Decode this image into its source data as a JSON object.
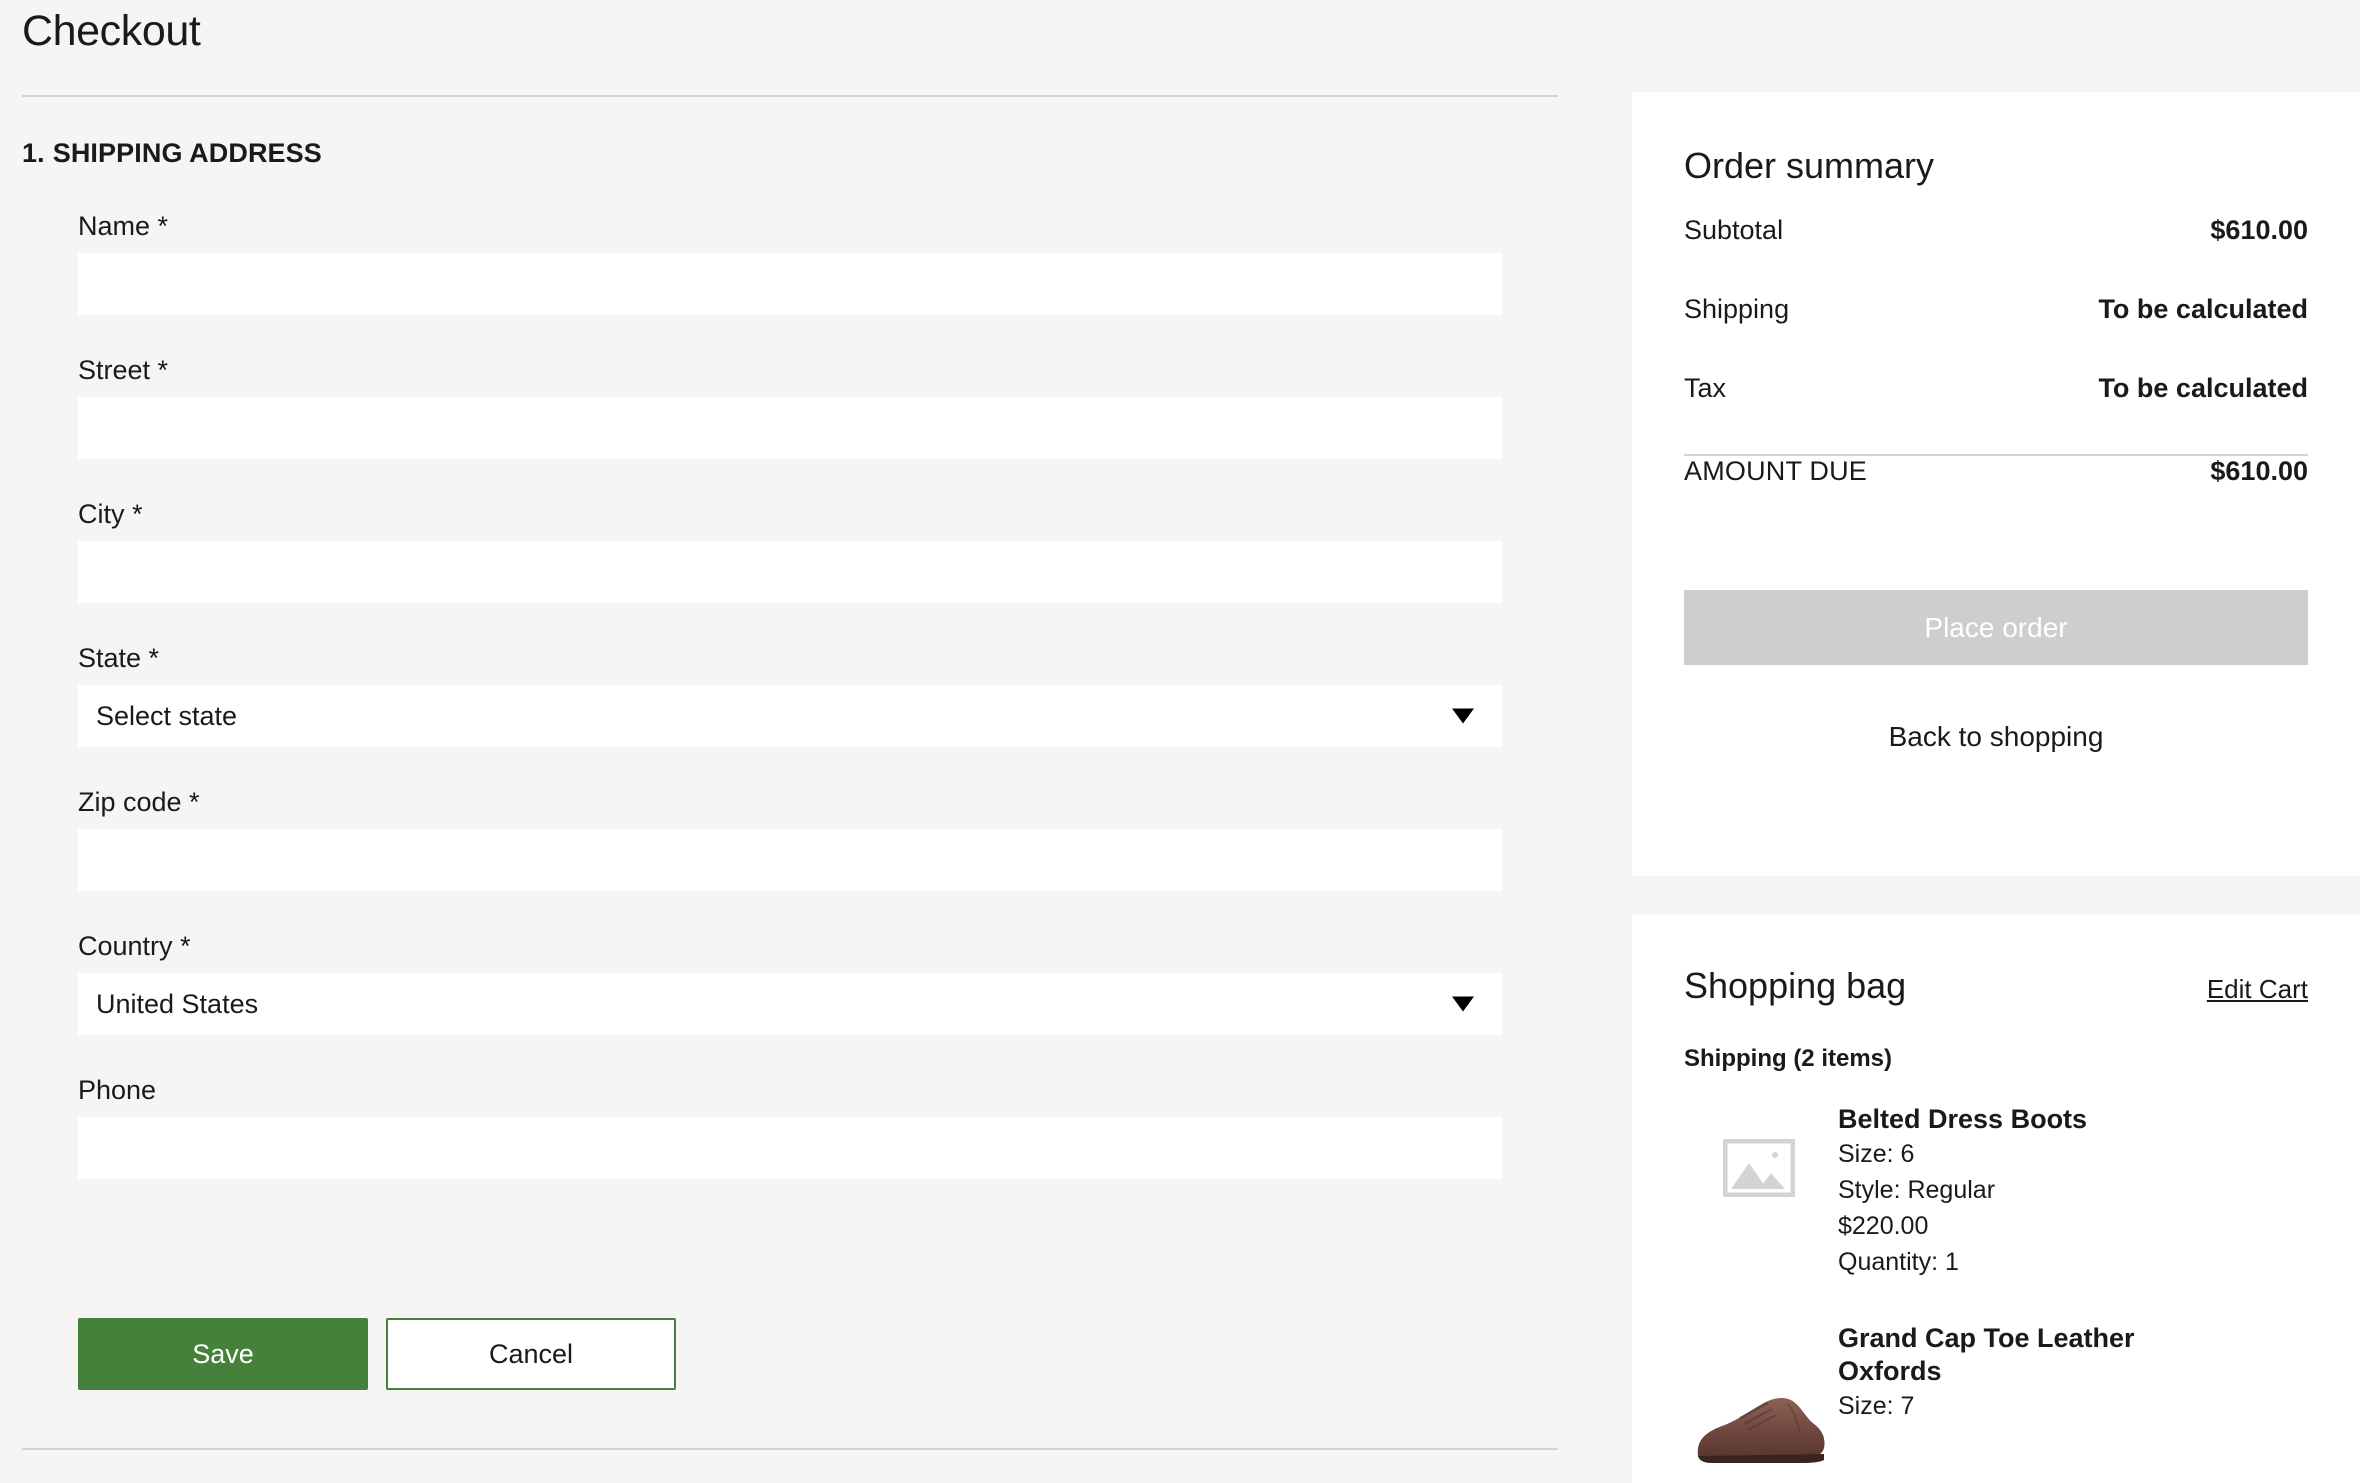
{
  "page": {
    "title": "Checkout"
  },
  "shipping_section": {
    "number": "1.",
    "heading": "SHIPPING ADDRESS",
    "fields": [
      {
        "label": "Name *",
        "value": "",
        "placeholder": "",
        "type": "text",
        "name": "name"
      },
      {
        "label": "Street *",
        "value": "",
        "placeholder": "",
        "type": "text",
        "name": "street"
      },
      {
        "label": "City *",
        "value": "",
        "placeholder": "",
        "type": "text",
        "name": "city"
      },
      {
        "label": "State *",
        "value": "Select state",
        "type": "select",
        "name": "state"
      },
      {
        "label": "Zip code *",
        "value": "",
        "placeholder": "",
        "type": "text",
        "name": "zip"
      },
      {
        "label": "Country *",
        "value": "United States",
        "type": "select",
        "name": "country"
      },
      {
        "label": "Phone",
        "value": "",
        "placeholder": "",
        "type": "text",
        "name": "phone"
      }
    ],
    "save_label": "Save",
    "cancel_label": "Cancel"
  },
  "order_summary": {
    "title": "Order summary",
    "rows": [
      {
        "label": "Subtotal",
        "value": "$610.00"
      },
      {
        "label": "Shipping",
        "value": "To be calculated"
      },
      {
        "label": "Tax",
        "value": "To be calculated"
      }
    ],
    "total_label": "AMOUNT DUE",
    "total_value": "$610.00",
    "place_order_label": "Place order",
    "back_link_label": "Back to shopping"
  },
  "shopping_bag": {
    "title": "Shopping bag",
    "edit_cart_label": "Edit Cart",
    "shipping_count_label": "Shipping (2 items)",
    "items": [
      {
        "name": "Belted Dress Boots",
        "size": "Size: 6",
        "style": "Style: Regular",
        "price": "$220.00",
        "quantity": "Quantity: 1",
        "thumb": "image-placeholder-icon"
      },
      {
        "name": "Grand Cap Toe Leather Oxfords",
        "size": "Size: 7",
        "style": "",
        "price": "",
        "quantity": "",
        "thumb": "shoe-photo"
      }
    ]
  },
  "colors": {
    "page_background": "#f6f5f3",
    "panel_background": "#ffffff",
    "accent_green": "#46813c",
    "disabled_gray": "#cecece",
    "divider": "#d2d2d2",
    "text": "#1a1a1a"
  }
}
